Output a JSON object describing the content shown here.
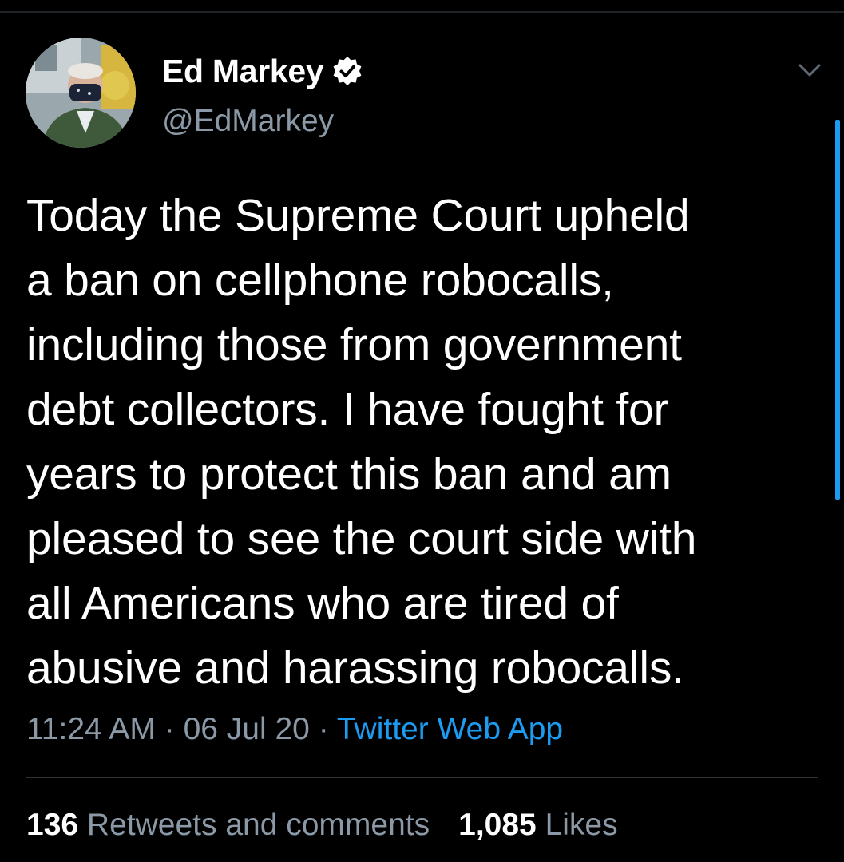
{
  "tweet": {
    "author": {
      "display_name": "Ed Markey",
      "handle": "@EdMarkey",
      "verified": true,
      "avatar_icon": "avatar-photo"
    },
    "text_lines": [
      "Today the Supreme Court upheld",
      "a ban on cellphone robocalls,",
      "including those from government",
      "debt collectors. I have fought for",
      "years to protect this ban and am",
      "pleased to see the court side with",
      "all Americans who are tired of",
      "abusive and harassing robocalls."
    ],
    "time": "11:24 AM",
    "separator": "·",
    "date": "06 Jul 20",
    "source": "Twitter Web App",
    "retweets_count": "136",
    "retweets_label": "Retweets and comments",
    "likes_count": "1,085",
    "likes_label": "Likes"
  },
  "icons": {
    "verified": "verified-badge-icon",
    "menu": "chevron-down-icon"
  },
  "colors": {
    "background": "#000000",
    "text_primary": "#ffffff",
    "text_secondary": "#8b98a5",
    "accent": "#1d9bf0",
    "divider": "#2f3336"
  }
}
